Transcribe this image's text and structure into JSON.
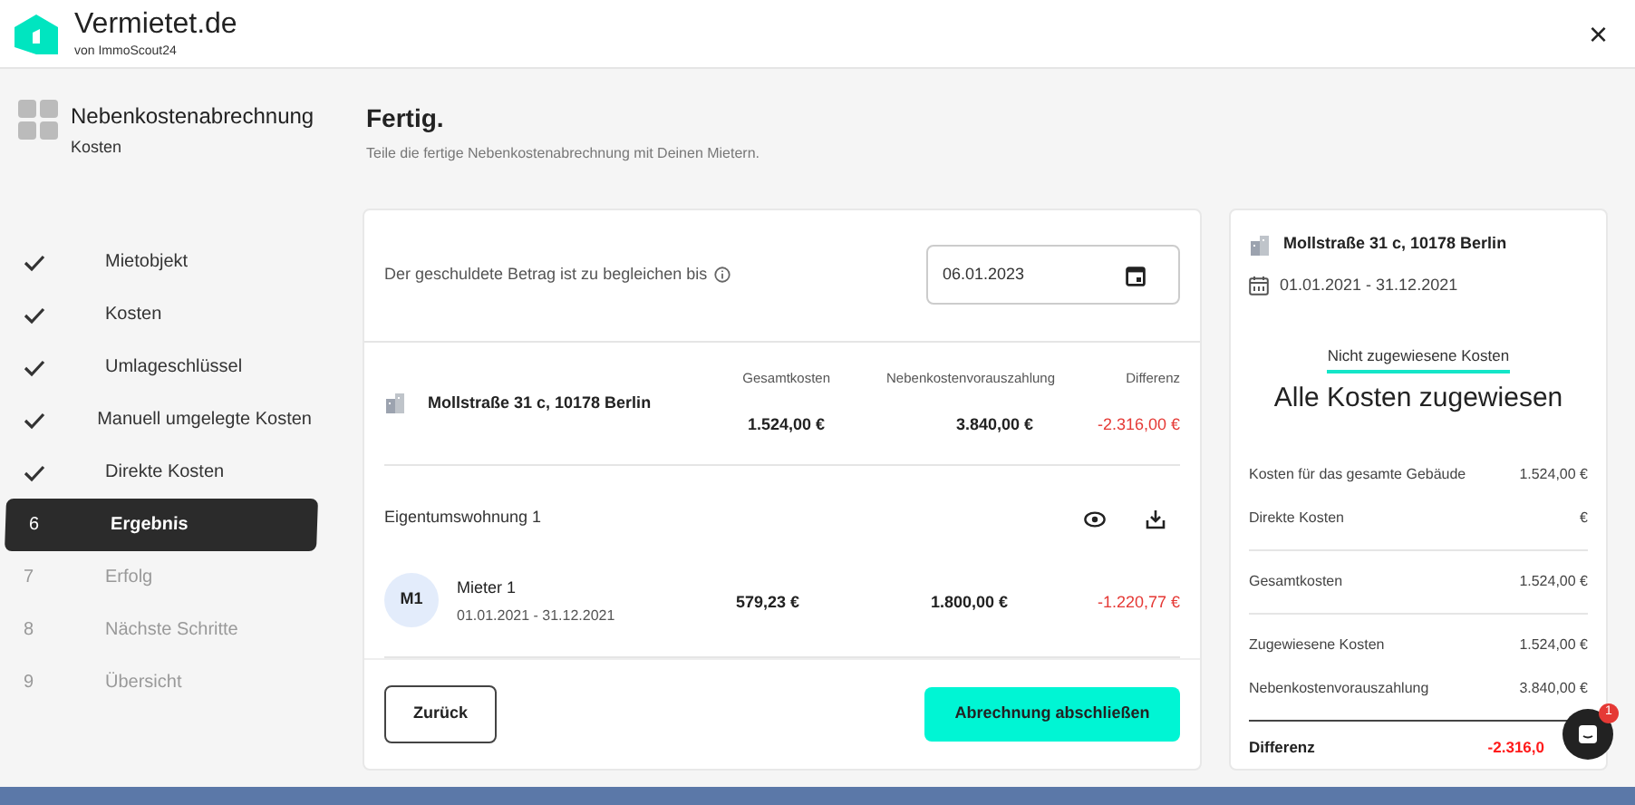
{
  "header": {
    "brand": "Vermietet.de",
    "tagline": "von ImmoScout24",
    "close": "×"
  },
  "sidebar": {
    "title": "Nebenkostenabrechnung",
    "subtitle": "Kosten",
    "steps": [
      {
        "label": "Mietobjekt",
        "done": true,
        "selected": false
      },
      {
        "label": "Kosten",
        "done": true,
        "selected": false
      },
      {
        "label": "Umlageschlüssel",
        "done": true,
        "selected": false
      },
      {
        "label": "Manuell umgelegte Kosten",
        "done": true,
        "selected": false
      },
      {
        "label": "Direkte Kosten",
        "done": true,
        "selected": false
      },
      {
        "number": "6",
        "label": "Ergebnis",
        "done": false,
        "selected": true
      },
      {
        "number": "7",
        "label": "Erfolg",
        "done": false,
        "selected": false
      },
      {
        "number": "8",
        "label": "Nächste Schritte",
        "done": false,
        "selected": false
      },
      {
        "number": "9",
        "label": "Übersicht",
        "done": false,
        "selected": false
      }
    ]
  },
  "page": {
    "title": "Fertig.",
    "subtitle": "Teile die fertige Nebenkostenabrechnung mit Deinen Mietern."
  },
  "main": {
    "due_label": "Der geschuldete Betrag ist zu begleichen bis",
    "due_date": "06.01.2023",
    "columns": [
      "Gesamtkosten",
      "Nebenkostenvorauszahlung",
      "Differenz"
    ],
    "property": {
      "address": "Mollstraße 31 c, 10178 Berlin",
      "total": "1.524,00 €",
      "prepayment": "3.840,00 €",
      "difference": "-2.316,00 €"
    },
    "unit": {
      "name": "Eigentumswohnung 1",
      "tenants": [
        {
          "initials": "M1",
          "name": "Mieter 1",
          "period": "01.01.2021 - 31.12.2021",
          "total": "579,23 €",
          "prepayment": "1.800,00 €",
          "difference": "-1.220,77 €"
        }
      ]
    },
    "back_button": "Zurück",
    "finish_button": "Abrechnung abschließen"
  },
  "summary": {
    "address": "Mollstraße 31 c, 10178 Berlin",
    "period": "01.01.2021 - 31.12.2021",
    "tab": "Nicht zugewiesene Kosten",
    "headline": "Alle Kosten zugewiesen",
    "groups": [
      [
        {
          "label": "Kosten für das gesamte Gebäude",
          "value": "1.524,00 €"
        },
        {
          "label": "Direkte Kosten",
          "value": "€"
        }
      ],
      [
        {
          "label": "Gesamtkosten",
          "value": "1.524,00 €"
        }
      ],
      [
        {
          "label": "Zugewiesene Kosten",
          "value": "1.524,00 €"
        },
        {
          "label": "Nebenkostenvorauszahlung",
          "value": "3.840,00 €"
        }
      ]
    ],
    "total_label": "Differenz",
    "total_value": "-2.316,0"
  },
  "chat": {
    "badge": "1"
  }
}
